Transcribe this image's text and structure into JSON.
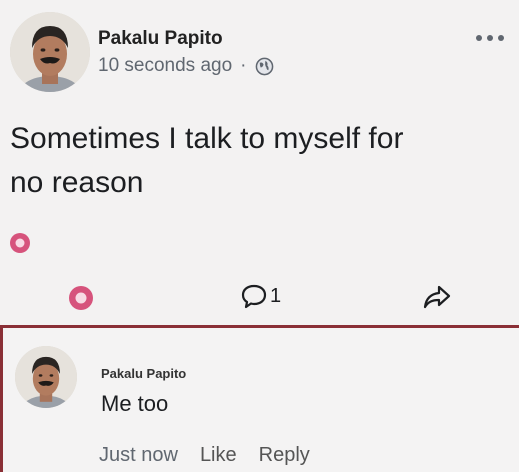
{
  "post": {
    "author": "Pakalu Papito",
    "time": "10 seconds ago",
    "separator": "·",
    "privacy_icon": "globe-icon",
    "text_line_1": "Sometimes I talk to myself for",
    "text_line_2": "no reason",
    "menu_icon": "more-options-icon"
  },
  "actions": {
    "react_icon": "reaction-icon",
    "comment_count": "1",
    "comment_icon": "comment-icon",
    "share_icon": "share-icon"
  },
  "comment": {
    "author": "Pakalu Papito",
    "text": "Me too",
    "time": "Just now",
    "like_label": "Like",
    "reply_label": "Reply"
  },
  "colors": {
    "highlight_border": "#8a2f36",
    "reaction_pink": "#d6537c",
    "meta_gray": "#606770"
  }
}
